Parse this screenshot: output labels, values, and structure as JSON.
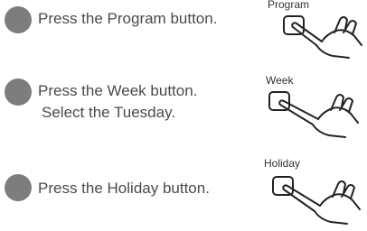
{
  "steps": [
    {
      "text_line1": "Press the Program button.",
      "text_line2": ""
    },
    {
      "text_line1": "Press the Week button.",
      "text_line2": "Select the Tuesday."
    },
    {
      "text_line1": "Press the Holiday button.",
      "text_line2": ""
    }
  ],
  "illustrations": [
    {
      "caption": "Program",
      "icon": "finger-press-button-icon"
    },
    {
      "caption": "Week",
      "icon": "finger-press-button-icon"
    },
    {
      "caption": "Holiday",
      "icon": "finger-press-button-icon"
    }
  ],
  "colors": {
    "bullet": "#7d7d7d",
    "text": "#4a4a4a",
    "line_art": "#222222"
  }
}
